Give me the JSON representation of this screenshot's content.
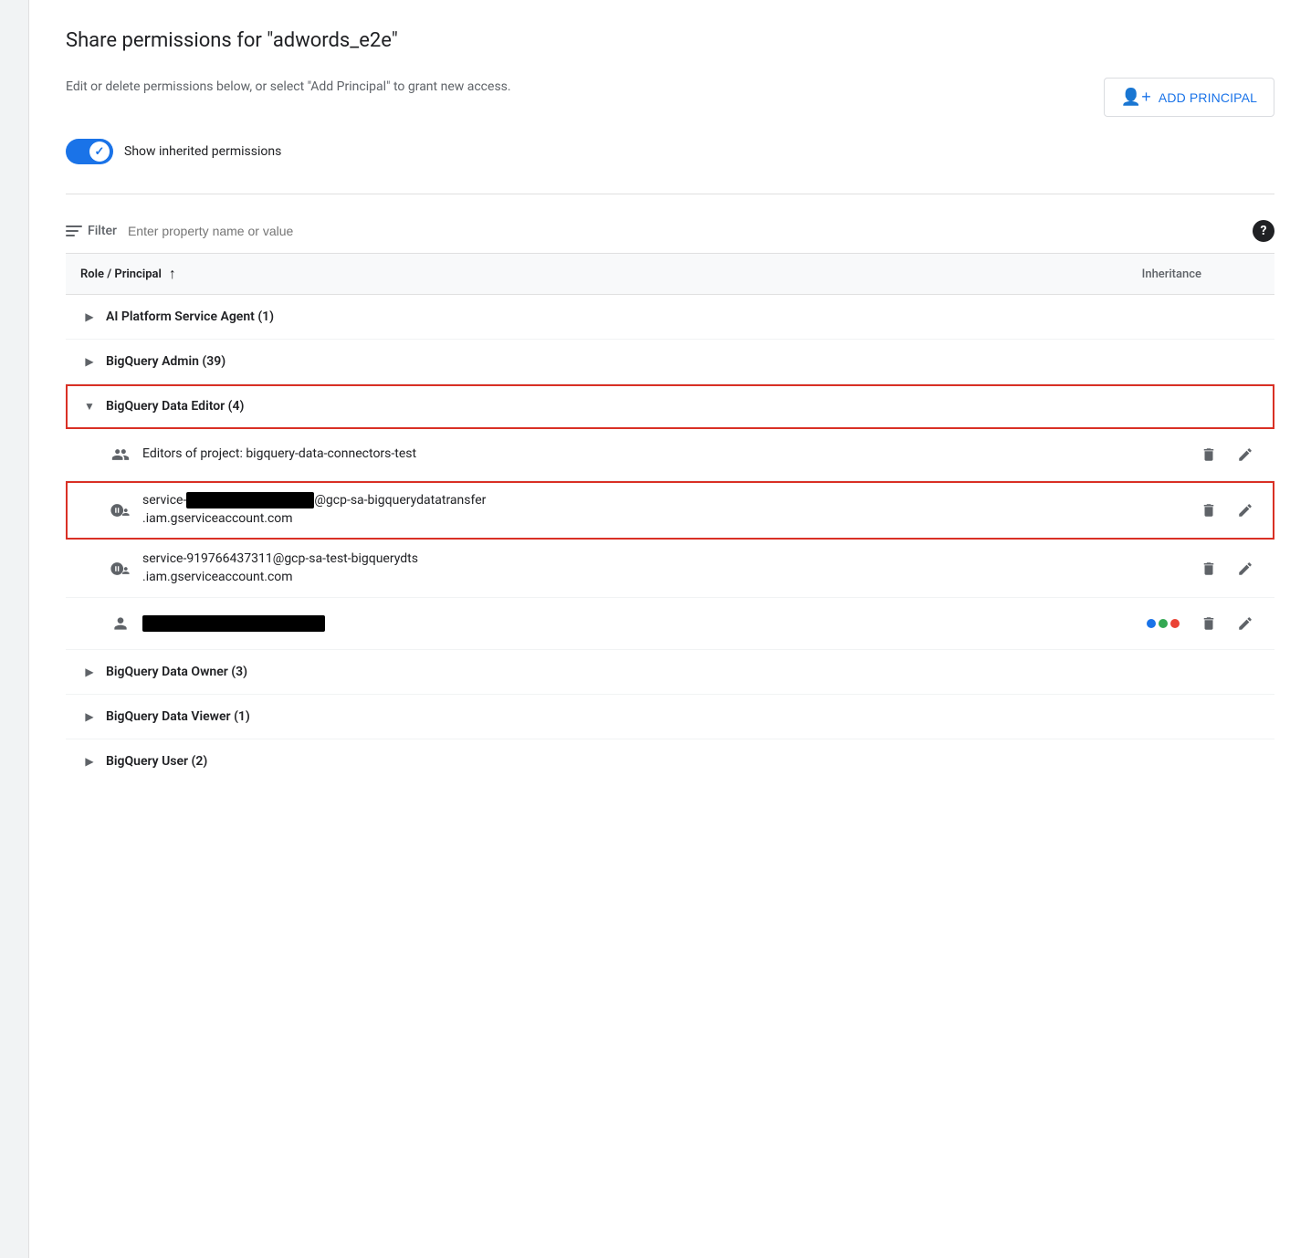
{
  "page": {
    "title": "Share permissions for \"adwords_e2e\""
  },
  "description": {
    "text": "Edit or delete permissions below, or select \"Add Principal\" to grant new access.",
    "add_principal_label": "ADD PRINCIPAL",
    "add_principal_icon": "person-add-icon"
  },
  "toggle": {
    "label": "Show inherited permissions",
    "enabled": true
  },
  "filter": {
    "label": "Filter",
    "placeholder": "Enter property name or value",
    "icon": "filter-icon",
    "help_icon": "help-icon"
  },
  "table": {
    "header_role": "Role / Principal",
    "header_inheritance": "Inheritance",
    "roles": [
      {
        "name": "AI Platform Service Agent (1)",
        "expanded": false,
        "principals": []
      },
      {
        "name": "BigQuery Admin (39)",
        "expanded": false,
        "principals": []
      },
      {
        "name": "BigQuery Data Editor (4)",
        "expanded": true,
        "highlighted": true,
        "principals": [
          {
            "type": "group",
            "name": "Editors of project: bigquery-data-connectors-test",
            "redacted": false,
            "highlighted": false,
            "has_inheritance": false
          },
          {
            "type": "service",
            "name_prefix": "service-",
            "name_redacted": true,
            "name_suffix": "@gcp-sa-bigquerydatatransfer\n.iam.gserviceaccount.com",
            "redacted": true,
            "highlighted": true,
            "has_inheritance": false
          },
          {
            "type": "service",
            "name": "service-919766437311@gcp-sa-test-bigquerydts\n.iam.gserviceaccount.com",
            "redacted": false,
            "highlighted": false,
            "has_inheritance": false
          },
          {
            "type": "person",
            "name": "",
            "redacted": true,
            "highlighted": false,
            "has_inheritance": true,
            "inheritance_colors": [
              "#1a73e8",
              "#34a853",
              "#ea4335"
            ]
          }
        ]
      },
      {
        "name": "BigQuery Data Owner (3)",
        "expanded": false,
        "principals": []
      },
      {
        "name": "BigQuery Data Viewer (1)",
        "expanded": false,
        "principals": []
      },
      {
        "name": "BigQuery User (2)",
        "expanded": false,
        "principals": []
      }
    ]
  },
  "icons": {
    "delete": "🗑",
    "edit": "✏",
    "sort_up": "↑"
  }
}
